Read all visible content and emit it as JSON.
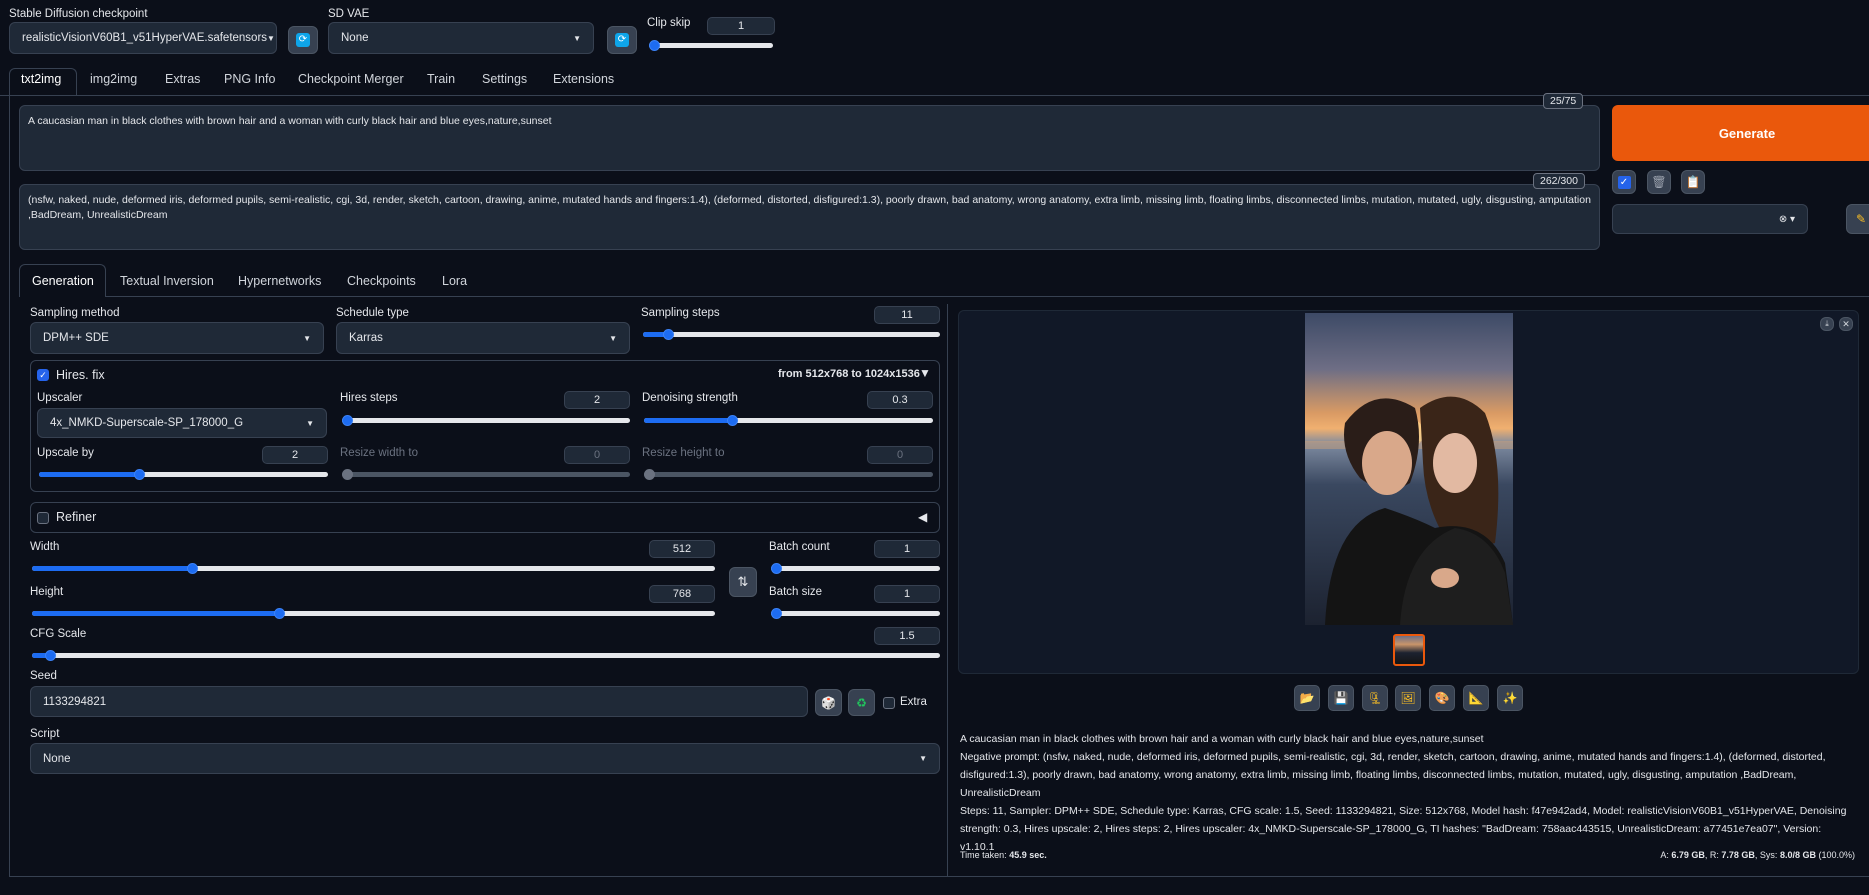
{
  "header": {
    "checkpoint_label": "Stable Diffusion checkpoint",
    "checkpoint_value": "realisticVisionV60B1_v51HyperVAE.safetensors",
    "vae_label": "SD VAE",
    "vae_value": "None",
    "clip_skip_label": "Clip skip",
    "clip_skip_value": "1",
    "clip_skip_fraction": 0
  },
  "tabs": [
    "txt2img",
    "img2img",
    "Extras",
    "PNG Info",
    "Checkpoint Merger",
    "Train",
    "Settings",
    "Extensions"
  ],
  "prompt": {
    "text": "A caucasian man in black clothes with brown hair  and a woman with curly black hair and blue eyes,nature,sunset",
    "counter": "25/75"
  },
  "negative_prompt": {
    "text": "(nsfw, naked, nude, deformed iris, deformed pupils, semi-realistic, cgi, 3d, render, sketch, cartoon, drawing, anime, mutated hands and fingers:1.4), (deformed, distorted, disfigured:1.3), poorly drawn, bad anatomy, wrong anatomy, extra limb, missing limb, floating limbs, disconnected limbs, mutation, mutated, ugly, disgusting, amputation ,BadDream, UnrealisticDream",
    "counter": "262/300"
  },
  "generate_label": "Generate",
  "subtabs": [
    "Generation",
    "Textual Inversion",
    "Hypernetworks",
    "Checkpoints",
    "Lora"
  ],
  "generation": {
    "sampling_method_label": "Sampling method",
    "sampling_method_value": "DPM++ SDE",
    "schedule_type_label": "Schedule type",
    "schedule_type_value": "Karras",
    "sampling_steps_label": "Sampling steps",
    "sampling_steps_value": "11",
    "hires": {
      "label": "Hires. fix",
      "resolution_text": "from 512x768  to 1024x1536",
      "upscaler_label": "Upscaler",
      "upscaler_value": "4x_NMKD-Superscale-SP_178000_G",
      "hires_steps_label": "Hires steps",
      "hires_steps_value": "2",
      "denoising_label": "Denoising strength",
      "denoising_value": "0.3",
      "upscale_by_label": "Upscale by",
      "upscale_by_value": "2",
      "resize_width_label": "Resize width to",
      "resize_width_value": "0",
      "resize_height_label": "Resize height to",
      "resize_height_value": "0"
    },
    "refiner_label": "Refiner",
    "width_label": "Width",
    "width_value": "512",
    "height_label": "Height",
    "height_value": "768",
    "batch_count_label": "Batch count",
    "batch_count_value": "1",
    "batch_size_label": "Batch size",
    "batch_size_value": "1",
    "cfg_label": "CFG Scale",
    "cfg_value": "1.5",
    "seed_label": "Seed",
    "seed_value": "1133294821",
    "extra_label": "Extra",
    "script_label": "Script",
    "script_value": "None"
  },
  "output": {
    "info_prompt": "A caucasian man in black clothes with brown hair and a woman with curly black hair and blue eyes,nature,sunset",
    "info_negative": "Negative prompt: (nsfw, naked, nude, deformed iris, deformed pupils, semi-realistic, cgi, 3d, render, sketch, cartoon, drawing, anime, mutated hands and fingers:1.4), (deformed, distorted, disfigured:1.3), poorly drawn, bad anatomy, wrong anatomy, extra limb, missing limb, floating limbs, disconnected limbs, mutation, mutated, ugly, disgusting, amputation ,BadDream, UnrealisticDream",
    "info_params": "Steps: 11, Sampler: DPM++ SDE, Schedule type: Karras, CFG scale: 1.5, Seed: 1133294821, Size: 512x768, Model hash: f47e942ad4, Model: realisticVisionV60B1_v51HyperVAE, Denoising strength: 0.3, Hires upscale: 2, Hires steps: 2, Hires upscaler: 4x_NMKD-Superscale-SP_178000_G, TI hashes: \"BadDream: 758aac443515, UnrealisticDream: a77451e7ea07\", Version: v1.10.1",
    "time_label": "Time taken: ",
    "time_value": "45.9 sec.",
    "vram_a_label": "A: ",
    "vram_a_value": "6.79 GB",
    "vram_r_label": ", R: ",
    "vram_r_value": "7.78 GB",
    "vram_sys_label": ", Sys: ",
    "vram_sys_value": "8.0/8 GB",
    "vram_pct": " (100.0%)"
  },
  "slider_fractions": {
    "sampling_steps": 0.07,
    "hires_steps": 0.0,
    "denoising": 0.3,
    "upscale_by": 0.34,
    "width": 0.23,
    "height": 0.36,
    "batch_count": 0,
    "batch_size": 0,
    "cfg": 0.015
  },
  "colors": {
    "accent_orange": "#ea580c",
    "slider_blue": "#1d6cf2",
    "background": "#0b0f19"
  }
}
